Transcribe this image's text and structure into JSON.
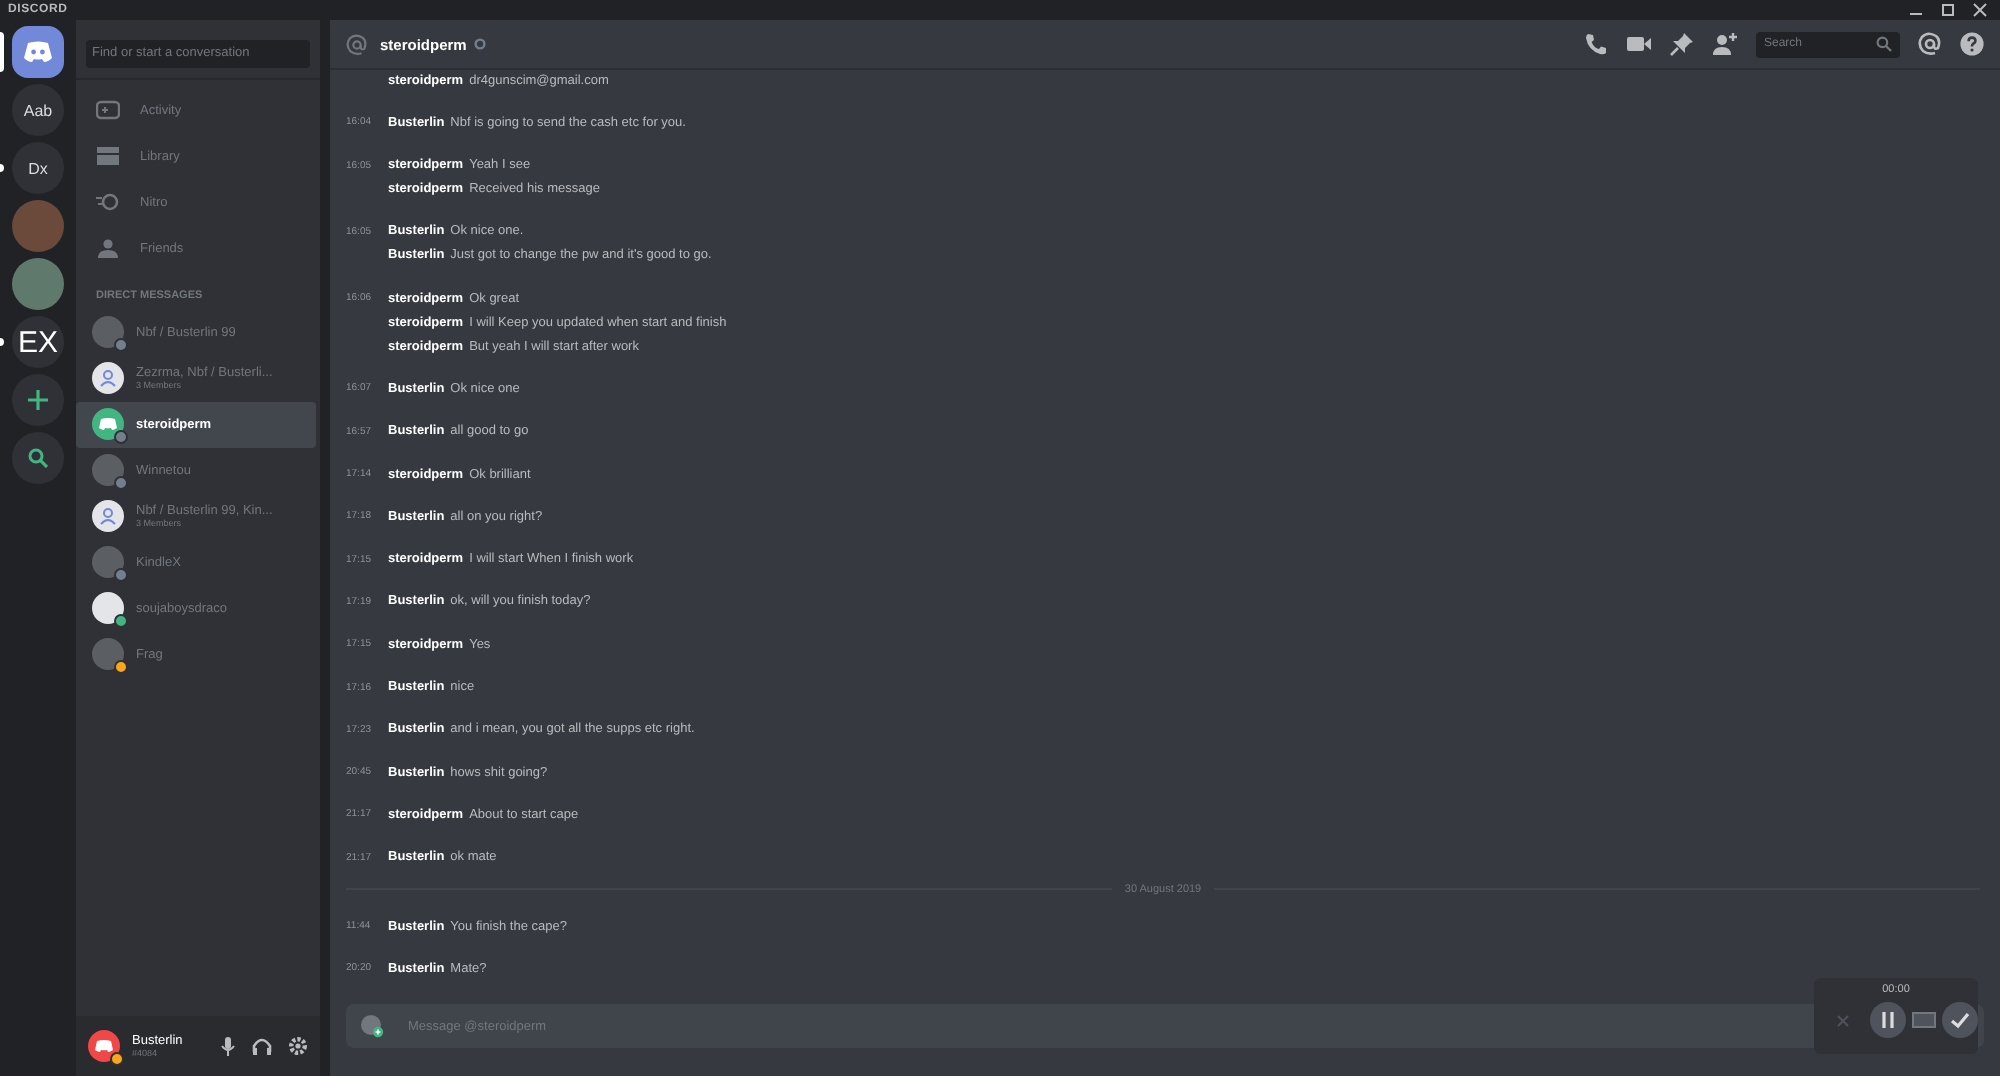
{
  "titlebar": {
    "title": "DISCORD"
  },
  "servers": [
    {
      "kind": "home",
      "selected": true
    },
    {
      "kind": "text",
      "label": "Aab",
      "selected": false,
      "unread": false
    },
    {
      "kind": "text",
      "label": "Dx",
      "selected": false,
      "unread": true
    },
    {
      "kind": "photo",
      "selected": false,
      "unread": false
    },
    {
      "kind": "photo",
      "selected": false,
      "unread": false
    },
    {
      "kind": "big",
      "label": "EX",
      "selected": false,
      "unread": true
    },
    {
      "kind": "add",
      "selected": false,
      "unread": false
    },
    {
      "kind": "explore",
      "selected": false,
      "unread": false
    }
  ],
  "dm_search": {
    "placeholder": "Find or start a conversation"
  },
  "nav": [
    {
      "kind": "activity",
      "label": "Activity"
    },
    {
      "kind": "library",
      "label": "Library"
    },
    {
      "kind": "nitro",
      "label": "Nitro"
    },
    {
      "kind": "friends",
      "label": "Friends"
    }
  ],
  "dm_heading": "DIRECT MESSAGES",
  "dms": [
    {
      "name": "Nbf / Busterlin 99",
      "kind": "photo",
      "color": "#747f8d",
      "selected": false
    },
    {
      "name": "Zezrma, Nbf / Busterli...",
      "subtitle": "3 Members",
      "kind": "group",
      "selected": false
    },
    {
      "name": "steroidperm",
      "kind": "discord",
      "color": "#747f8d",
      "selected": true
    },
    {
      "name": "Winnetou",
      "kind": "photo",
      "color": "#747f8d",
      "selected": false
    },
    {
      "name": "Nbf / Busterlin 99, Kin...",
      "subtitle": "3 Members",
      "kind": "group",
      "selected": false
    },
    {
      "name": "KindleX",
      "kind": "photo",
      "color": "#747f8d",
      "selected": false
    },
    {
      "name": "soujaboysdraco",
      "kind": "white",
      "color": "#43b581",
      "selected": false
    },
    {
      "name": "Frag",
      "kind": "photo",
      "color": "#faa61a",
      "selected": false
    }
  ],
  "user": {
    "name": "Busterlin",
    "tag": "#4084",
    "color": "#faa61a"
  },
  "chat": {
    "recipient": "steroidperm",
    "search_placeholder": "Search"
  },
  "messages": [
    {
      "kind": "group",
      "lines": [
        {
          "author": "steroidperm",
          "text": "dr4gunscim@gmail.com"
        }
      ]
    },
    {
      "kind": "group",
      "time": "16:04",
      "lines": [
        {
          "author": "Busterlin",
          "text": "Nbf is going to send the cash etc for you."
        }
      ]
    },
    {
      "kind": "group",
      "time": "16:05",
      "lines": [
        {
          "author": "steroidperm",
          "text": "Yeah I see"
        },
        {
          "author": "steroidperm",
          "text": "Received his message"
        }
      ]
    },
    {
      "kind": "group",
      "time": "16:05",
      "lines": [
        {
          "author": "Busterlin",
          "text": "Ok nice one."
        },
        {
          "author": "Busterlin",
          "text": "Just got to change the pw and it's good to go."
        }
      ]
    },
    {
      "kind": "group",
      "time": "16:06",
      "lines": [
        {
          "author": "steroidperm",
          "text": "Ok great"
        },
        {
          "author": "steroidperm",
          "text": "I will Keep you updated when start and finish"
        },
        {
          "author": "steroidperm",
          "text": "But yeah I will start after work"
        }
      ]
    },
    {
      "kind": "group",
      "time": "16:07",
      "lines": [
        {
          "author": "Busterlin",
          "text": "Ok nice one"
        }
      ]
    },
    {
      "kind": "group",
      "time": "16:57",
      "lines": [
        {
          "author": "Busterlin",
          "text": "all good to go"
        }
      ]
    },
    {
      "kind": "group",
      "time": "17:14",
      "lines": [
        {
          "author": "steroidperm",
          "text": "Ok brilliant"
        }
      ]
    },
    {
      "kind": "group",
      "time": "17:18",
      "lines": [
        {
          "author": "Busterlin",
          "text": "all on you right?"
        }
      ]
    },
    {
      "kind": "group",
      "time": "17:15",
      "lines": [
        {
          "author": "steroidperm",
          "text": "I will start When I finish work"
        }
      ]
    },
    {
      "kind": "group",
      "time": "17:19",
      "lines": [
        {
          "author": "Busterlin",
          "text": "ok, will you finish today?"
        }
      ]
    },
    {
      "kind": "group",
      "time": "17:15",
      "lines": [
        {
          "author": "steroidperm",
          "text": "Yes"
        }
      ]
    },
    {
      "kind": "group",
      "time": "17:16",
      "lines": [
        {
          "author": "Busterlin",
          "text": "nice"
        }
      ]
    },
    {
      "kind": "group",
      "time": "17:23",
      "lines": [
        {
          "author": "Busterlin",
          "text": "and i mean, you got all the supps etc right."
        }
      ]
    },
    {
      "kind": "group",
      "time": "20:45",
      "lines": [
        {
          "author": "Busterlin",
          "text": "hows shit going?"
        }
      ]
    },
    {
      "kind": "group",
      "time": "21:17",
      "lines": [
        {
          "author": "steroidperm",
          "text": "About to start cape"
        }
      ]
    },
    {
      "kind": "group",
      "time": "21:17",
      "lines": [
        {
          "author": "Busterlin",
          "text": "ok mate"
        }
      ]
    },
    {
      "kind": "divider",
      "label": "30 August 2019"
    },
    {
      "kind": "group",
      "time": "11:44",
      "lines": [
        {
          "author": "Busterlin",
          "text": "You finish the cape?"
        }
      ]
    },
    {
      "kind": "group",
      "time": "20:20",
      "lines": [
        {
          "author": "Busterlin",
          "text": "Mate?"
        }
      ]
    }
  ],
  "composer": {
    "placeholder": "Message @steroidperm"
  },
  "recorder": {
    "time": "00:00"
  }
}
